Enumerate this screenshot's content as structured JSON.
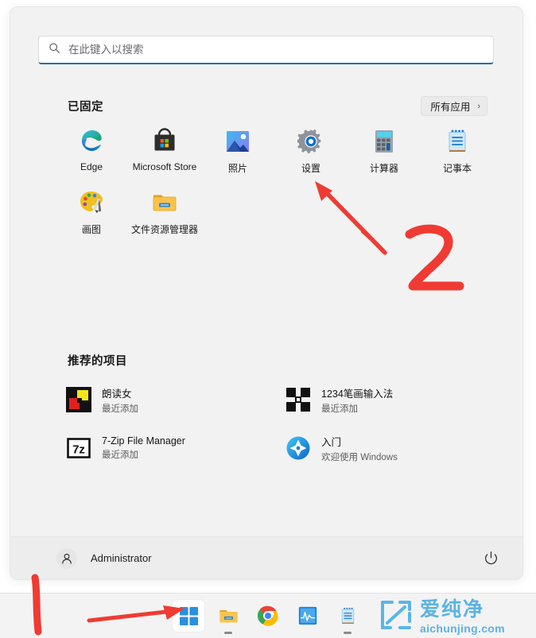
{
  "start_menu": {
    "search": {
      "placeholder": "在此键入以搜索",
      "value": "",
      "icon": "search-icon"
    },
    "pinned": {
      "heading": "已固定",
      "all_apps_label": "所有应用",
      "all_apps_chevron": "›",
      "apps": [
        {
          "label": "Edge",
          "icon": "edge-icon"
        },
        {
          "label": "Microsoft Store",
          "icon": "microsoft-store-icon"
        },
        {
          "label": "照片",
          "icon": "photos-icon"
        },
        {
          "label": "设置",
          "icon": "settings-gear-icon"
        },
        {
          "label": "计算器",
          "icon": "calculator-icon"
        },
        {
          "label": "记事本",
          "icon": "notepad-icon"
        },
        {
          "label": "画图",
          "icon": "paint-palette-icon"
        },
        {
          "label": "文件资源管理器",
          "icon": "file-explorer-folder-icon"
        }
      ]
    },
    "recommended": {
      "heading": "推荐的项目",
      "items": [
        {
          "title": "朗读女",
          "subtitle": "最近添加",
          "icon": "langdunv-icon"
        },
        {
          "title": "1234笔画输入法",
          "subtitle": "最近添加",
          "icon": "bihua-ime-icon"
        },
        {
          "title": "7-Zip File Manager",
          "subtitle": "最近添加",
          "icon": "sevenzip-icon"
        },
        {
          "title": "入门",
          "subtitle": "欢迎使用 Windows",
          "icon": "get-started-icon"
        }
      ]
    },
    "footer": {
      "user_name": "Administrator",
      "avatar_icon": "user-avatar-icon",
      "power_icon": "power-icon"
    }
  },
  "taskbar": {
    "items": [
      {
        "name": "start-button",
        "icon": "windows-logo-icon",
        "active": true,
        "running": false
      },
      {
        "name": "file-explorer",
        "icon": "file-explorer-folder-icon",
        "active": false,
        "running": true
      },
      {
        "name": "google-chrome",
        "icon": "chrome-icon",
        "active": false,
        "running": false
      },
      {
        "name": "task-manager",
        "icon": "task-manager-icon",
        "active": false,
        "running": false
      },
      {
        "name": "notepad",
        "icon": "notepad-icon",
        "active": false,
        "running": true
      }
    ]
  },
  "watermark": {
    "chinese": "爱纯净",
    "domain": "aichunjing.com",
    "color": "#5bb3e4"
  },
  "annotations": {
    "color": "#ef3b33",
    "step_one_label": "1",
    "step_two_label": "2",
    "arrow_to_start_button": "arrow pointing right at Start button",
    "arrow_to_settings": "arrow pointing up-left at 设置"
  }
}
